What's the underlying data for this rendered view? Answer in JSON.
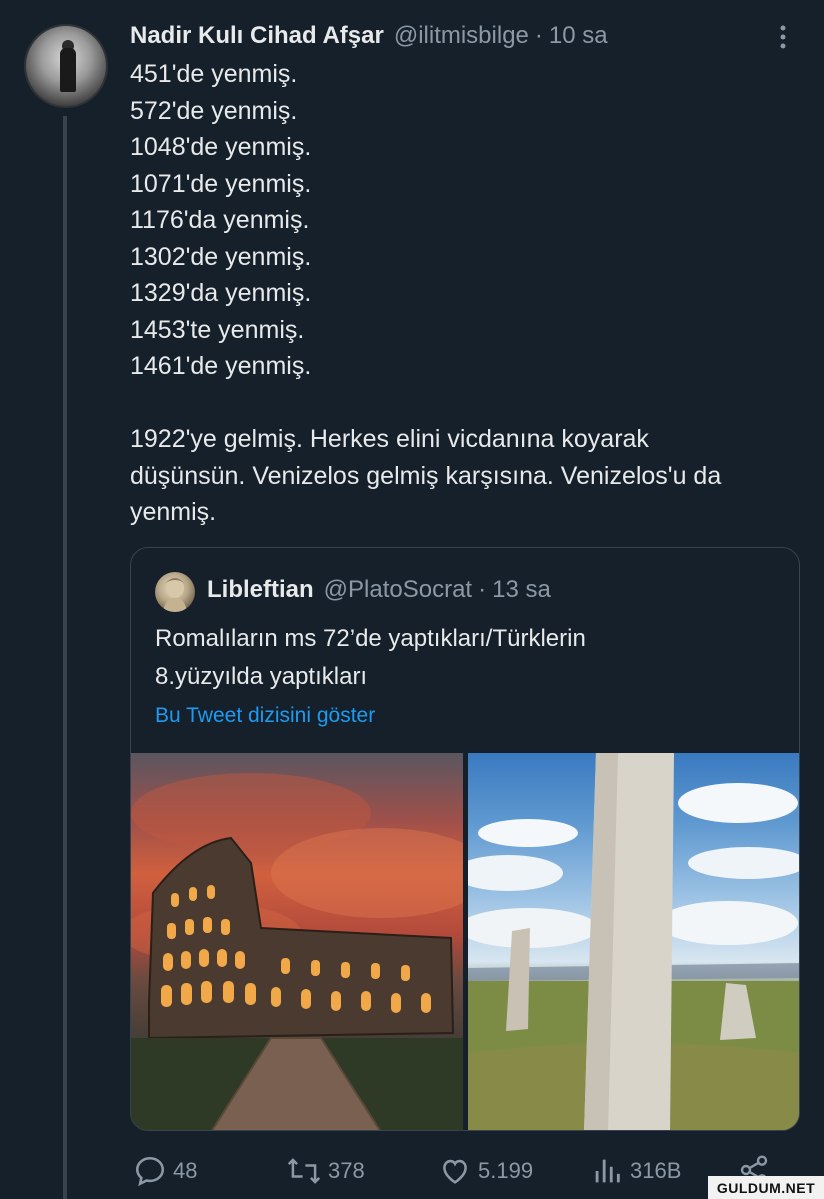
{
  "tweet": {
    "author_name": "Nadir Kulı Cihad Afşar",
    "handle": "@ilitmisbilge",
    "separator": "·",
    "time": "10 sa",
    "lines": [
      "451'de yenmiş.",
      "572'de yenmiş.",
      "1048'de yenmiş.",
      "1071'de yenmiş.",
      "1176'da yenmiş.",
      "1302'de yenmiş.",
      "1329'da yenmiş.",
      "1453'te yenmiş.",
      "1461'de yenmiş.",
      "",
      "1922'ye gelmiş. Herkes elini vicdanına koyarak",
      "düşünsün. Venizelos gelmiş karşısına. Venizelos'u da",
      "yenmiş."
    ]
  },
  "quote": {
    "author_name": "Libleftian",
    "handle": "@PlatoSocrat",
    "separator": "·",
    "time": "13 sa",
    "text_line1": "Romalıların ms 72’de yaptıkları/Türklerin",
    "text_line2": "8.yüzyılda yaptıkları",
    "show_thread": "Bu Tweet dizisini göster"
  },
  "actions": {
    "replies": "48",
    "retweets": "378",
    "likes": "5.199",
    "views": "316B"
  },
  "watermark": "GULDUM.NET",
  "colors": {
    "background": "#15202b",
    "text": "#e7e9ea",
    "muted": "#8b98a5",
    "link": "#1d9bf0",
    "border": "#38444d"
  },
  "icons": [
    "more-icon",
    "reply-icon",
    "retweet-icon",
    "like-icon",
    "views-icon",
    "share-icon"
  ]
}
